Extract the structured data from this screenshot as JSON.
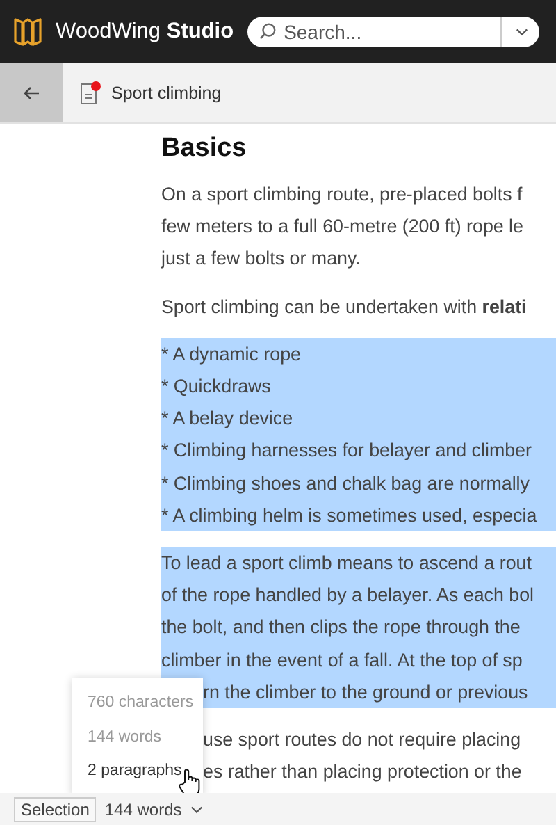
{
  "header": {
    "logo_text": "WoodWing **Studio**",
    "search": {
      "placeholder": "Search..."
    }
  },
  "toolbar": {
    "document_title": "Sport climbing",
    "modified": true
  },
  "content": {
    "heading": "Basics",
    "blocks": [
      {
        "selected": false,
        "lines": [
          {
            "text": "On a sport climbing route, pre-placed bolts f",
            "covered": false
          },
          {
            "text": "few meters to a full 60-metre (200 ft) rope le",
            "covered": false
          },
          {
            "text": "just a few bolts or many.",
            "covered": false
          }
        ]
      },
      {
        "selected": false,
        "lines": [
          {
            "text": "Sport climbing can be undertaken with **relati**",
            "covered": false
          }
        ]
      },
      {
        "selected": true,
        "lines": [
          {
            "text": "* A dynamic rope",
            "covered": false
          },
          {
            "text": "* Quickdraws",
            "covered": false
          },
          {
            "text": "* A belay device",
            "covered": false
          },
          {
            "text": "* Climbing harnesses for belayer and climber",
            "covered": false
          },
          {
            "text": "* Climbing shoes and chalk bag are normally",
            "covered": false
          },
          {
            "text": "* A climbing helm is sometimes used, especia",
            "covered": false
          }
        ]
      },
      {
        "selected": true,
        "lines": [
          {
            "text": "To lead a sport climb means to ascend a rout",
            "covered": false
          },
          {
            "text": "of the rope handled by a belayer. As each bol",
            "covered": false
          },
          {
            "text": "the bolt, and then clips the rope through the",
            "covered": false
          },
          {
            "text": "climber in the event of a fall. At the top of sp",
            "covered": false
          },
          {
            "text": "rn the climber to the ground or previous",
            "covered": true
          }
        ]
      },
      {
        "selected": false,
        "lines": [
          {
            "text": "use sport routes do not require placing",
            "covered": true
          },
          {
            "text": "es rather than placing protection or the",
            "covered": true
          }
        ]
      }
    ]
  },
  "count_menu": {
    "items": [
      {
        "label": "760 characters",
        "hovered": false
      },
      {
        "label": "144 words",
        "hovered": false
      },
      {
        "label": "2 paragraphs",
        "hovered": true
      }
    ]
  },
  "status_bar": {
    "selection_label": "Selection",
    "count": "144 words"
  }
}
